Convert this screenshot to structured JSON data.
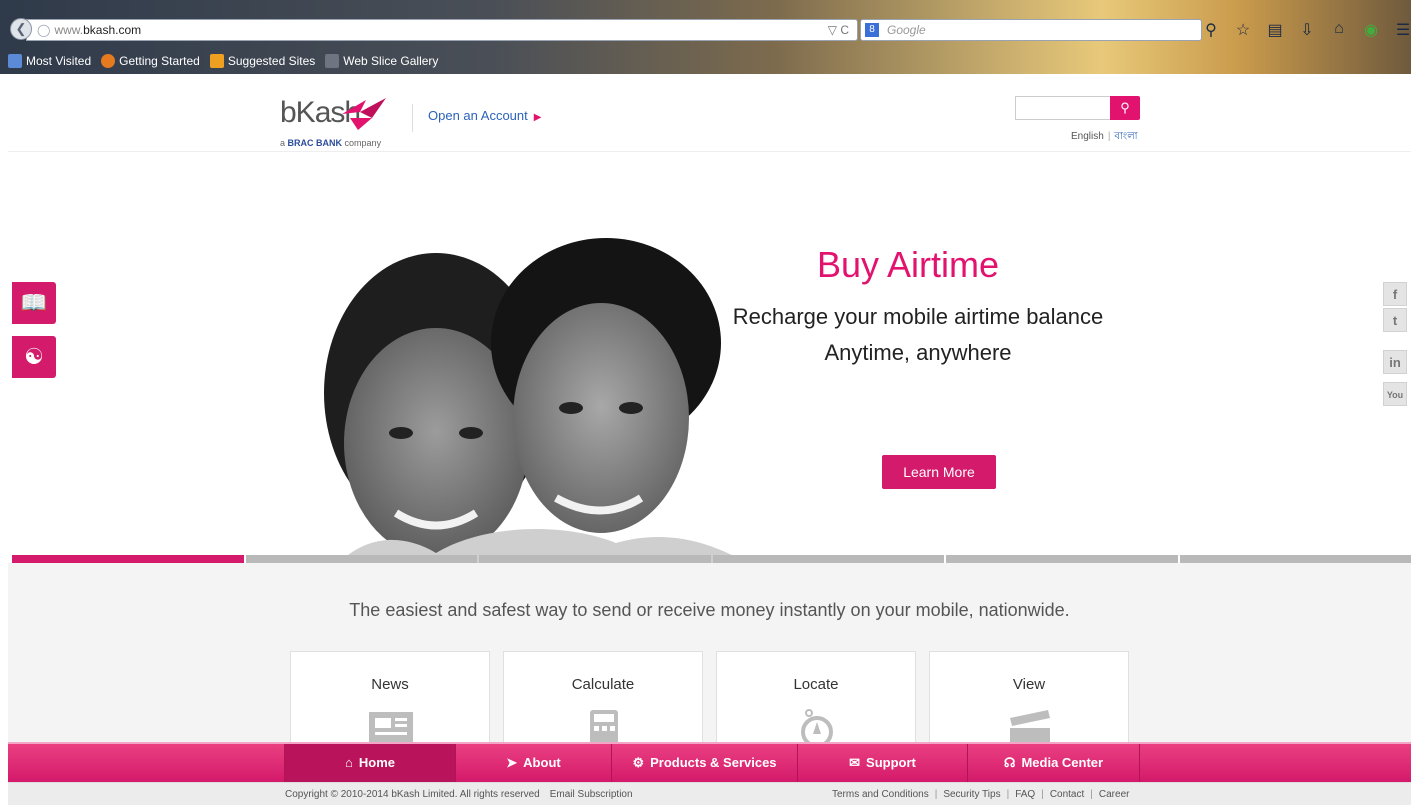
{
  "browser": {
    "url_prefix": "www.",
    "url_domain": "bkash.com",
    "search_placeholder": "Google",
    "bookmarks": [
      "Most Visited",
      "Getting Started",
      "Suggested Sites",
      "Web Slice Gallery"
    ]
  },
  "header": {
    "logo_text": "bKash",
    "logo_sub_prefix": "a",
    "logo_sub_brand": "BRAC BANK",
    "logo_sub_suffix": "company",
    "open_account": "Open an Account",
    "lang_en": "English",
    "lang_bn": "বাংলা"
  },
  "hero": {
    "title": "Buy Airtime",
    "subtitle_line1": "Recharge your mobile airtime balance",
    "subtitle_line2": "Anytime, anywhere",
    "cta": "Learn More",
    "active_slide": 1,
    "slide_count": 6
  },
  "tagline": "The easiest and safest way to send or receive money instantly on your mobile, nationwide.",
  "cards": [
    "News",
    "Calculate",
    "Locate",
    "View"
  ],
  "social": [
    "f",
    "t",
    "in",
    "You"
  ],
  "footer_nav": [
    "Home",
    "About",
    "Products & Services",
    "Support",
    "Media Center"
  ],
  "footer": {
    "copyright": "Copyright © 2010-2014 bKash Limited. All rights reserved",
    "email_sub": "Email Subscription",
    "links": [
      "Terms and Conditions",
      "Security Tips",
      "FAQ",
      "Contact",
      "Career"
    ]
  },
  "colors": {
    "brand": "#e2136e",
    "button": "#d41a6b"
  }
}
